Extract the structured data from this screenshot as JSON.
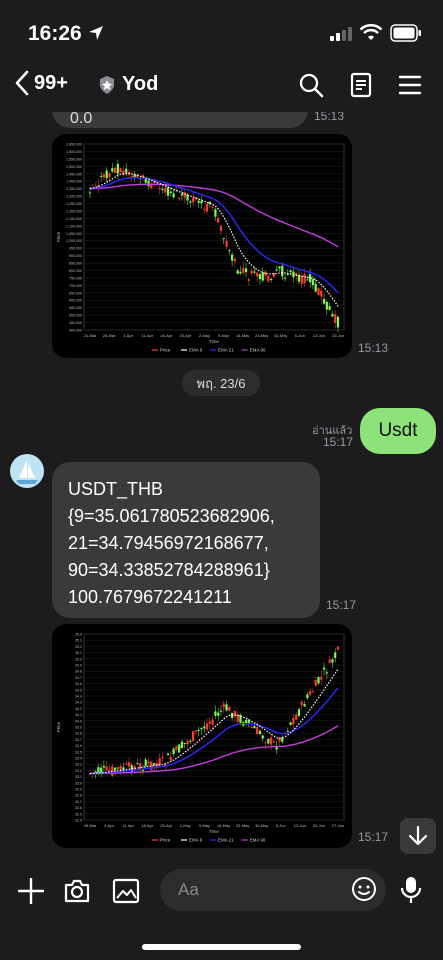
{
  "status_bar": {
    "time": "16:26"
  },
  "header": {
    "unread_count": "99+",
    "chat_name": "Yod"
  },
  "messages": {
    "top_partial_text": "0.0",
    "top_partial_time": "15:13",
    "btc_chart_time": "15:13",
    "date_divider": "พฤ. 23/6",
    "user_msg": "Usdt",
    "read_label": "อ่านแล้ว",
    "user_msg_time": "15:17",
    "reply_lines": [
      "USDT_THB",
      "{9=35.061780523682906,",
      "21=34.79456972168677,",
      "90=34.33852784288961}",
      "100.7679672241211"
    ],
    "reply_time": "15:17",
    "usdt_chart_time": "15:17"
  },
  "charts": {
    "btc": {
      "ylabel": "Price",
      "xlabel": "Time",
      "yticks": [
        "1,650,000",
        "1,600,000",
        "1,550,000",
        "1,500,000",
        "1,450,000",
        "1,400,000",
        "1,350,000",
        "1,300,000",
        "1,250,000",
        "1,200,000",
        "1,150,000",
        "1,100,000",
        "1,050,000",
        "1,000,000",
        "950,000",
        "900,000",
        "850,000",
        "800,000",
        "750,000",
        "700,000",
        "650,000",
        "600,000",
        "550,000",
        "500,000",
        "450,000",
        "400,000"
      ],
      "xticks": [
        "21-Mar",
        "28-Mar",
        "4-Apr",
        "11-Apr",
        "18-Apr",
        "25-Apr",
        "2-May",
        "9-May",
        "16-May",
        "23-May",
        "30-May",
        "6-Jun",
        "13-Jun",
        "20-Jun"
      ],
      "legend": [
        "Price",
        "EMA 9",
        "EMA 21",
        "EMA 90"
      ]
    },
    "usdt": {
      "ylabel": "Price",
      "xlabel": "Time",
      "yticks": [
        "35.4",
        "35.3",
        "35.2",
        "35.1",
        "35.0",
        "34.9",
        "34.8",
        "34.7",
        "34.6",
        "34.5",
        "34.4",
        "34.3",
        "34.2",
        "34.1",
        "34.0",
        "33.9",
        "33.8",
        "33.7",
        "33.6",
        "33.5",
        "33.4",
        "33.3",
        "33.2",
        "33.1",
        "33.0",
        "32.9",
        "32.8",
        "32.7",
        "32.6",
        "32.5",
        "32.4"
      ],
      "xticks": [
        "28-Mar",
        "4-Apr",
        "11-Apr",
        "18-Apr",
        "25-Apr",
        "2-May",
        "9-May",
        "16-May",
        "23-May",
        "30-May",
        "6-Jun",
        "13-Jun",
        "20-Jun",
        "27-Jun"
      ],
      "legend": [
        "Price",
        "EMA 9",
        "EMA 21",
        "EMA 90"
      ]
    },
    "colors": {
      "up": "#7dff4a",
      "down": "#ff3b30",
      "ema9": "#ffffff",
      "ema21": "#2a2aff",
      "ema90": "#c43cdc",
      "legend_price": "#ff3b30"
    }
  },
  "input": {
    "placeholder": "Aa"
  }
}
